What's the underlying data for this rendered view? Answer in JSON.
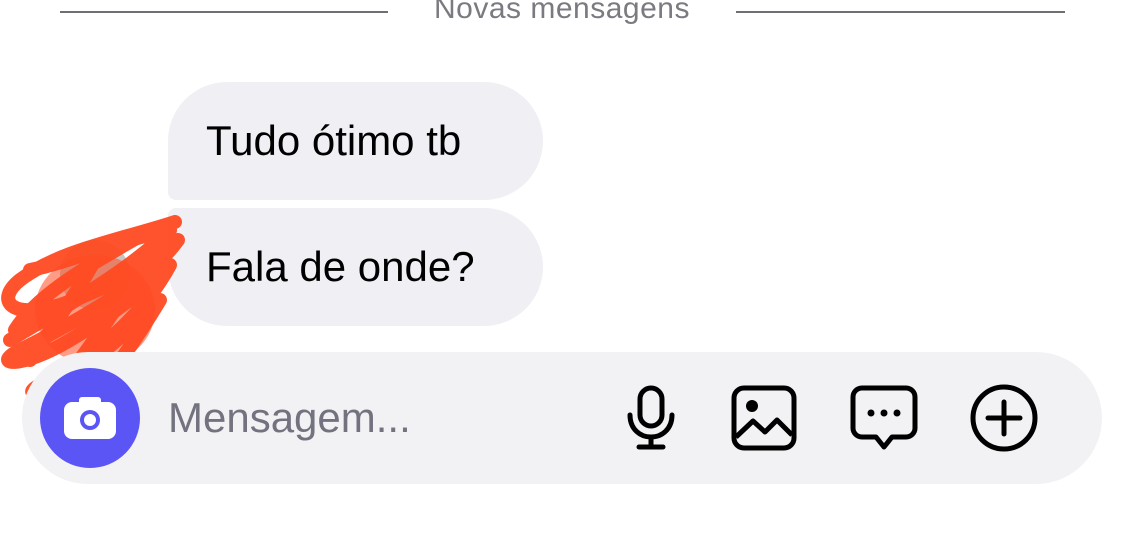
{
  "divider": {
    "label": "Novas mensagens"
  },
  "messages": [
    {
      "text": "Tudo ótimo tb"
    },
    {
      "text": "Fala de onde?"
    }
  ],
  "composer": {
    "placeholder": "Mensagem...",
    "camera_icon": "camera-icon",
    "tools": [
      "microphone-icon",
      "image-icon",
      "chat-bubble-icon",
      "add-circle-icon"
    ]
  },
  "colors": {
    "accent": "#5b55f5",
    "bubble": "#efeff4",
    "composer": "#f2f2f5",
    "scribble": "#ff4a22"
  }
}
